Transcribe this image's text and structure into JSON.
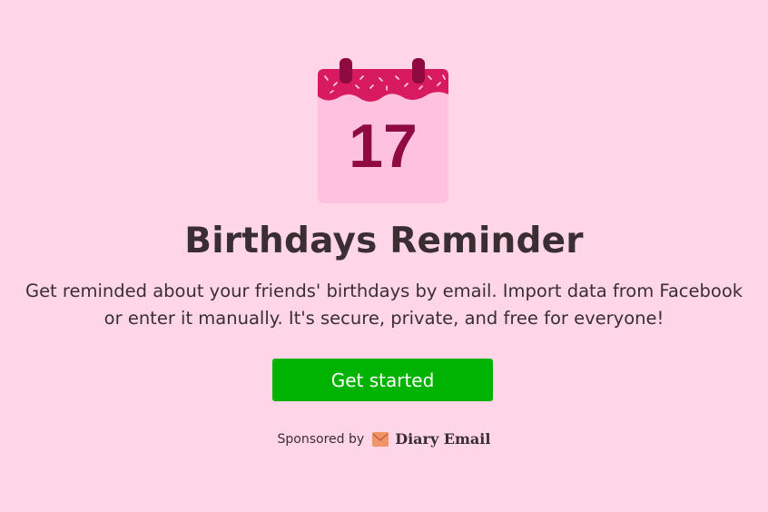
{
  "app": {
    "calendar_day": "17",
    "title": "Birthdays Reminder",
    "description": "Get reminded about your friends' birthdays by email. Import data from Facebook or enter it manually. It's secure, private, and free for everyone!"
  },
  "cta": {
    "label": "Get started"
  },
  "sponsor": {
    "label": "Sponsored by",
    "name": "Diary Email",
    "icon": "envelope-icon"
  },
  "colors": {
    "background": "#ffd5e8",
    "accent_green": "#00b300",
    "calendar_top": "#d81b60",
    "calendar_body": "#ffc1dd",
    "calendar_number": "#8e0a3f",
    "text": "#3a2e33"
  }
}
